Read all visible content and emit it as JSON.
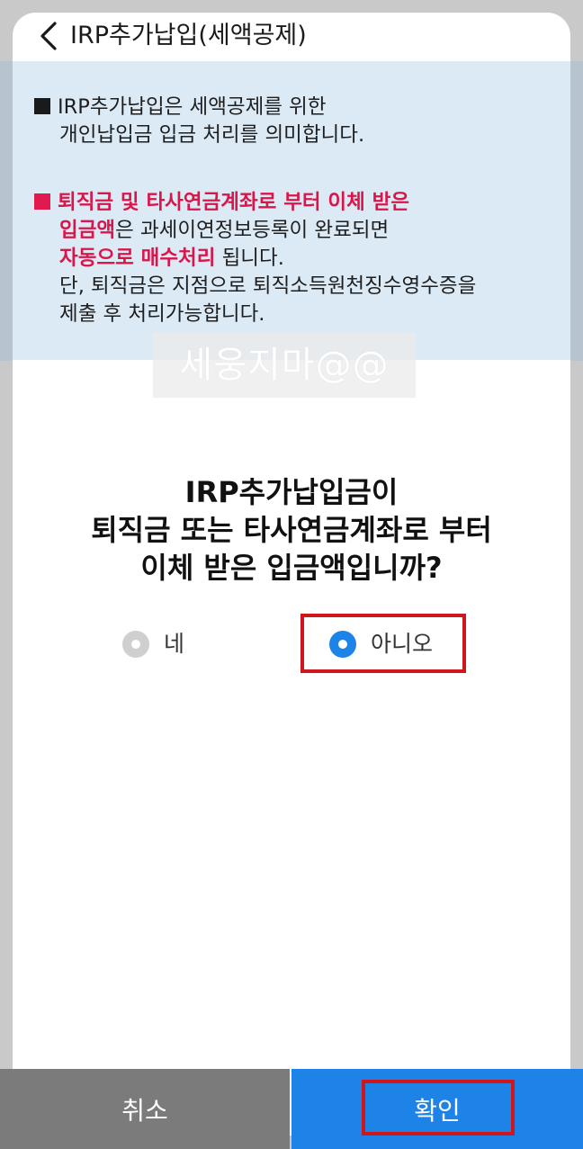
{
  "header": {
    "title": "IRP추가납입(세액공제)",
    "back_icon": "chevron-left-icon"
  },
  "notice": {
    "p1_line1": "IRP추가납입은 세액공제를 위한",
    "p1_line2": "개인납입금 입금 처리를 의미합니다.",
    "p2_red1": "퇴직금 및 타사연금계좌로 부터 이체 받은",
    "p2_red2": "입금액",
    "p2_text2": "은 과세이연정보등록이 완료되면",
    "p2_red3": "자동으로 매수처리",
    "p2_text3": " 됩니다.",
    "p2_line4": "단, 퇴직금은 지점으로 퇴직소득원천징수영수증을",
    "p2_line5": "제출 후 처리가능합니다."
  },
  "watermark": "세웅지마@@",
  "question": {
    "line1": "IRP추가납입금이",
    "line2": "퇴직금 또는 타사연금계좌로 부터",
    "line3": "이체 받은 입금액입니까?"
  },
  "options": {
    "yes_label": "네",
    "no_label": "아니오",
    "selected": "아니오"
  },
  "buttons": {
    "cancel": "취소",
    "confirm": "확인"
  },
  "colors": {
    "accent": "#1e83e6",
    "warning": "#d8164a",
    "notice_bg": "#dceaf6",
    "highlight_box": "#d0151c"
  }
}
